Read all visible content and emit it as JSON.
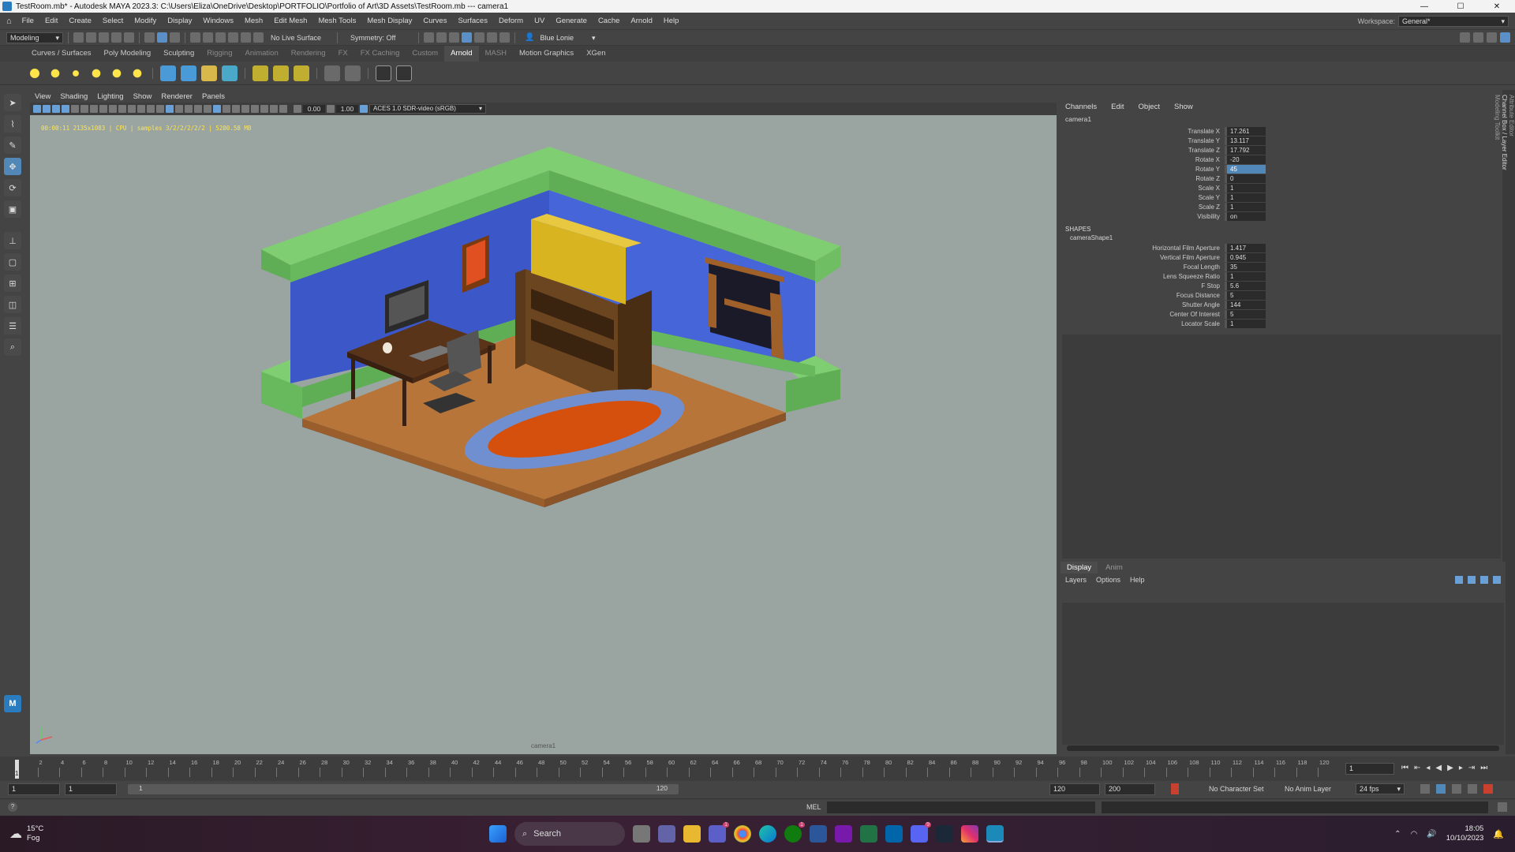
{
  "titlebar": {
    "text": "TestRoom.mb* - Autodesk MAYA 2023.3: C:\\Users\\Eliza\\OneDrive\\Desktop\\PORTFOLIO\\Portfolio of Art\\3D Assets\\TestRoom.mb  ---  camera1",
    "minimize": "—",
    "maximize": "☐",
    "close": "✕"
  },
  "menubar": {
    "items": [
      "File",
      "Edit",
      "Create",
      "Select",
      "Modify",
      "Display",
      "Windows",
      "Mesh",
      "Edit Mesh",
      "Mesh Tools",
      "Mesh Display",
      "Curves",
      "Surfaces",
      "Deform",
      "UV",
      "Generate",
      "Cache",
      "Arnold",
      "Help"
    ],
    "workspace_label": "Workspace:",
    "workspace_value": "General*"
  },
  "statusline": {
    "menuset": "Modeling",
    "live_surface": "No Live Surface",
    "symmetry": "Symmetry: Off",
    "user": "Blue Lonie"
  },
  "shelf_tabs": [
    {
      "label": "Curves / Surfaces",
      "state": "normal"
    },
    {
      "label": "Poly Modeling",
      "state": "normal"
    },
    {
      "label": "Sculpting",
      "state": "normal"
    },
    {
      "label": "Rigging",
      "state": "dim"
    },
    {
      "label": "Animation",
      "state": "dim"
    },
    {
      "label": "Rendering",
      "state": "dim"
    },
    {
      "label": "FX",
      "state": "dim"
    },
    {
      "label": "FX Caching",
      "state": "dim"
    },
    {
      "label": "Custom",
      "state": "dim"
    },
    {
      "label": "Arnold",
      "state": "active"
    },
    {
      "label": "MASH",
      "state": "dim"
    },
    {
      "label": "Motion Graphics",
      "state": "normal"
    },
    {
      "label": "XGen",
      "state": "normal"
    }
  ],
  "viewport": {
    "menu": [
      "View",
      "Shading",
      "Lighting",
      "Show",
      "Renderer",
      "Panels"
    ],
    "exposure": "0.00",
    "gamma": "1.00",
    "colorspace": "ACES 1.0 SDR-video (sRGB)",
    "hud": "00:00:11 2135x1083 | CPU | samples 3/2/2/2/2/2 | 5200.58 MB",
    "camera_label": "camera1"
  },
  "channel_box": {
    "menu": [
      "Channels",
      "Edit",
      "Object",
      "Show"
    ],
    "object": "camera1",
    "attributes": [
      {
        "name": "Translate X",
        "value": "17.261"
      },
      {
        "name": "Translate Y",
        "value": "13.117"
      },
      {
        "name": "Translate Z",
        "value": "17.792"
      },
      {
        "name": "Rotate X",
        "value": "-20"
      },
      {
        "name": "Rotate Y",
        "value": "45"
      },
      {
        "name": "Rotate Z",
        "value": "0"
      },
      {
        "name": "Scale X",
        "value": "1"
      },
      {
        "name": "Scale Y",
        "value": "1"
      },
      {
        "name": "Scale Z",
        "value": "1"
      },
      {
        "name": "Visibility",
        "value": "on"
      }
    ],
    "shapes_label": "SHAPES",
    "shape_name": "cameraShape1",
    "shape_attributes": [
      {
        "name": "Horizontal Film Aperture",
        "value": "1.417"
      },
      {
        "name": "Vertical Film Aperture",
        "value": "0.945"
      },
      {
        "name": "Focal Length",
        "value": "35"
      },
      {
        "name": "Lens Squeeze Ratio",
        "value": "1"
      },
      {
        "name": "F Stop",
        "value": "5.6"
      },
      {
        "name": "Focus Distance",
        "value": "5"
      },
      {
        "name": "Shutter Angle",
        "value": "144"
      },
      {
        "name": "Center Of Interest",
        "value": "5"
      },
      {
        "name": "Locator Scale",
        "value": "1"
      }
    ]
  },
  "side_tabs": [
    "Attribute Editor",
    "Channel Box / Layer Editor",
    "Modeling Toolkit"
  ],
  "layer_editor": {
    "tabs": [
      "Display",
      "Anim"
    ],
    "menu": [
      "Layers",
      "Options",
      "Help"
    ]
  },
  "timeline": {
    "ticks": [
      "2",
      "4",
      "6",
      "8",
      "10",
      "12",
      "14",
      "16",
      "18",
      "20",
      "22",
      "24",
      "26",
      "28",
      "30",
      "32",
      "34",
      "36",
      "38",
      "40",
      "42",
      "44",
      "46",
      "48",
      "50",
      "52",
      "54",
      "56",
      "58",
      "60",
      "62",
      "64",
      "66",
      "68",
      "70",
      "72",
      "74",
      "76",
      "78",
      "80",
      "82",
      "84",
      "86",
      "88",
      "90",
      "92",
      "94",
      "96",
      "98",
      "100",
      "102",
      "104",
      "106",
      "108",
      "110",
      "112",
      "114",
      "116",
      "118",
      "120"
    ],
    "current_frame_marker": "1",
    "current_frame": "1"
  },
  "range": {
    "start": "1",
    "playback_start": "1",
    "slider_start": "1",
    "slider_end": "120",
    "playback_end": "120",
    "anim_end": "200",
    "character_set": "No Character Set",
    "anim_layer": "No Anim Layer",
    "fps": "24 fps"
  },
  "cmdline": {
    "label": "MEL"
  },
  "taskbar": {
    "weather_temp": "15°C",
    "weather_desc": "Fog",
    "search": "Search",
    "time": "18:05",
    "date": "10/10/2023",
    "badge_teams": "1",
    "badge_xbox": "1",
    "badge_discord": "9"
  }
}
